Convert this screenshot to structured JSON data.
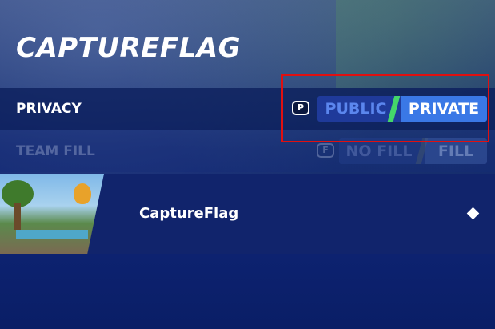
{
  "screen": {
    "title": "CAPTUREFLAG"
  },
  "settings": [
    {
      "label": "PRIVACY",
      "key_hint": "P",
      "options": [
        "PUBLIC",
        "PRIVATE"
      ],
      "selected": "PRIVATE",
      "enabled": true
    },
    {
      "label": "TEAM FILL",
      "key_hint": "F",
      "options": [
        "NO FILL",
        "FILL"
      ],
      "selected": "FILL",
      "enabled": false
    }
  ],
  "mode": {
    "name": "CaptureFlag",
    "icon": "diamond-icon"
  },
  "colors": {
    "highlight": "#e01010",
    "selected_option": "#3a78e6",
    "divider_slash": "#44d66a"
  }
}
